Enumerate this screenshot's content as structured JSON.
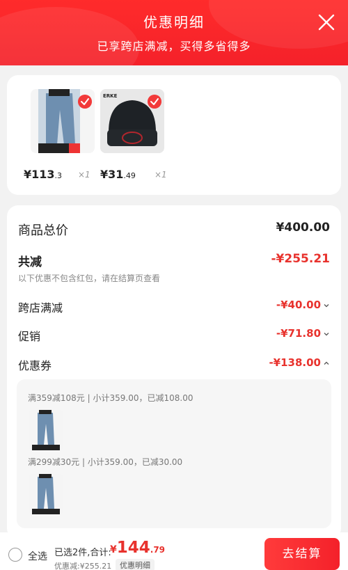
{
  "header": {
    "title": "优惠明细",
    "subtitle": "已享跨店满减，买得多省得多"
  },
  "products": [
    {
      "price_int": "¥113",
      "price_dec": ".3",
      "qty": "×1",
      "image": "jeans-image",
      "checked": true
    },
    {
      "price_int": "¥31",
      "price_dec": ".49",
      "qty": "×1",
      "image": "beanie-image",
      "checked": true
    }
  ],
  "summary": {
    "total_label": "商品总价",
    "total_value": "¥400.00",
    "reduction_label": "共减",
    "reduction_value": "-¥255.21",
    "reduction_note": "以下优惠不包含红包，请在结算页查看",
    "rows": [
      {
        "label": "跨店满减",
        "value": "-¥40.00"
      },
      {
        "label": "促销",
        "value": "-¥71.80"
      },
      {
        "label": "优惠券",
        "value": "-¥138.00"
      }
    ]
  },
  "coupons": [
    {
      "text": "满359减108元 | 小计359.00，已减108.00"
    },
    {
      "text": "满299减30元 | 小计359.00，已减30.00"
    }
  ],
  "footer": {
    "select_all": "全选",
    "selected_text": "已选2件,合计:",
    "currency": "¥",
    "amount_int": "144",
    "amount_dec": ".79",
    "discount_text": "优惠减:¥255.21",
    "detail_tag": "优惠明细",
    "checkout_label": "去结算"
  },
  "colors": {
    "accent_red": "#f4212a",
    "discount_red": "#e8322d"
  }
}
